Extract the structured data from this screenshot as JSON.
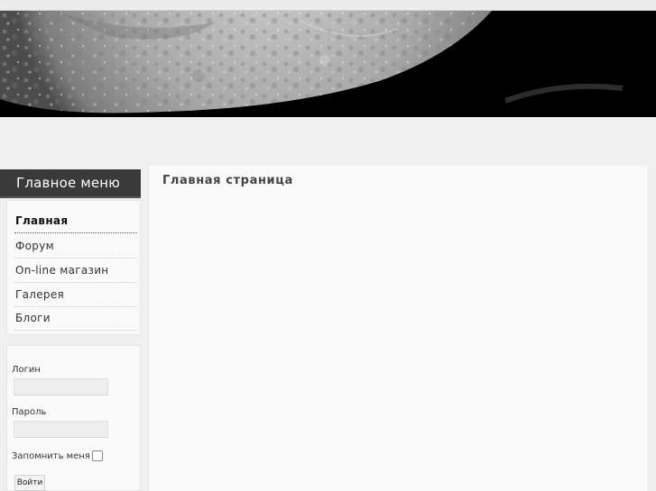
{
  "main_menu": {
    "title": "Главное меню",
    "items": [
      {
        "label": "Главная",
        "active": true
      },
      {
        "label": "Форум"
      },
      {
        "label": "On-line магазин"
      },
      {
        "label": "Галерея"
      },
      {
        "label": "Блоги"
      }
    ]
  },
  "login": {
    "login_label": "Логин",
    "password_label": "Пароль",
    "remember_label": "Запомнить меня",
    "submit_label": "Войти"
  },
  "content": {
    "title": "Главная страница"
  },
  "colors": {
    "banner_bg": "#000000",
    "menu_title_bg": "#3a3a3a",
    "page_bg": "#f0f0f0",
    "panel_bg": "#fafafa"
  }
}
